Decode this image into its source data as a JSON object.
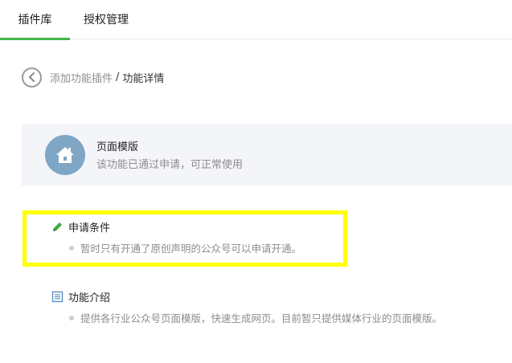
{
  "tabs": [
    {
      "label": "插件库",
      "active": true
    },
    {
      "label": "授权管理",
      "active": false
    }
  ],
  "breadcrumb": {
    "parent": "添加功能插件",
    "separator": "/",
    "current": "功能详情"
  },
  "feature": {
    "icon": "home-icon",
    "name": "页面模版",
    "status": "该功能已通过申请，可正常使用"
  },
  "sections": {
    "conditions": {
      "icon": "pen-icon",
      "title": "申请条件",
      "item": "暂时只有开通了原创声明的公众号可以申请开通。"
    },
    "intro": {
      "icon": "document-icon",
      "title": "功能介绍",
      "item": "提供各行业公众号页面模版，快速生成网页。目前暂只提供媒体行业的页面模版。"
    }
  },
  "colors": {
    "accent_green": "#44b549",
    "highlight_yellow": "#ffff00",
    "icon_blue": "#7fa6c5",
    "card_bg": "#f4f5f9"
  }
}
